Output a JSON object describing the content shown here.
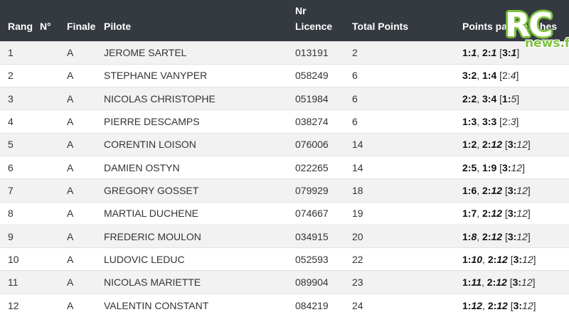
{
  "table": {
    "headers": {
      "rang": "Rang",
      "num": "N°",
      "finale": "Finale",
      "pilote": "Pilote",
      "licence_line1": "Nr",
      "licence_line2": "Licence",
      "total": "Total Points",
      "points": "Points par manches"
    },
    "rows": [
      {
        "rang": "1",
        "finale": "A",
        "pilote": "JEROME SARTEL",
        "licence": "013191",
        "total": "2",
        "points": [
          {
            "b": "1:",
            "i": "1"
          },
          {
            "sep": ", "
          },
          {
            "b": "2:",
            "i": "1"
          },
          {
            "sep": " ["
          },
          {
            "b": "3:",
            "i": "1"
          },
          {
            "sep": "]"
          }
        ]
      },
      {
        "rang": "2",
        "finale": "A",
        "pilote": "STEPHANE VANYPER",
        "licence": "058249",
        "total": "6",
        "points": [
          {
            "b": "3:2"
          },
          {
            "sep": ", "
          },
          {
            "b": "1:4"
          },
          {
            "sep": " [2:"
          },
          {
            "i": "4"
          },
          {
            "sep": "]"
          }
        ]
      },
      {
        "rang": "3",
        "finale": "A",
        "pilote": "NICOLAS CHRISTOPHE",
        "licence": "051984",
        "total": "6",
        "points": [
          {
            "b": "2:2"
          },
          {
            "sep": ", "
          },
          {
            "b": "3:4"
          },
          {
            "sep": " ["
          },
          {
            "b": "1:"
          },
          {
            "i": "5"
          },
          {
            "sep": "]"
          }
        ]
      },
      {
        "rang": "4",
        "finale": "A",
        "pilote": "PIERRE DESCAMPS",
        "licence": "038274",
        "total": "6",
        "points": [
          {
            "b": "1:3"
          },
          {
            "sep": ", "
          },
          {
            "b": "3:3"
          },
          {
            "sep": " [2:"
          },
          {
            "i": "3"
          },
          {
            "sep": "]"
          }
        ]
      },
      {
        "rang": "5",
        "finale": "A",
        "pilote": "CORENTIN LOISON",
        "licence": "076006",
        "total": "14",
        "points": [
          {
            "b": "1:2"
          },
          {
            "sep": ", "
          },
          {
            "b": "2:",
            "i": "12"
          },
          {
            "sep": " ["
          },
          {
            "b": "3:"
          },
          {
            "i": "12"
          },
          {
            "sep": "]"
          }
        ]
      },
      {
        "rang": "6",
        "finale": "A",
        "pilote": "DAMIEN OSTYN",
        "licence": "022265",
        "total": "14",
        "points": [
          {
            "b": "2:5"
          },
          {
            "sep": ", "
          },
          {
            "b": "1:9"
          },
          {
            "sep": " ["
          },
          {
            "b": "3:"
          },
          {
            "i": "12"
          },
          {
            "sep": "]"
          }
        ]
      },
      {
        "rang": "7",
        "finale": "A",
        "pilote": "GREGORY GOSSET",
        "licence": "079929",
        "total": "18",
        "points": [
          {
            "b": "1:6"
          },
          {
            "sep": ", "
          },
          {
            "b": "2:",
            "i": "12"
          },
          {
            "sep": " ["
          },
          {
            "b": "3:"
          },
          {
            "i": "12"
          },
          {
            "sep": "]"
          }
        ]
      },
      {
        "rang": "8",
        "finale": "A",
        "pilote": "MARTIAL DUCHENE",
        "licence": "074667",
        "total": "19",
        "points": [
          {
            "b": "1:7"
          },
          {
            "sep": ", "
          },
          {
            "b": "2:",
            "i": "12"
          },
          {
            "sep": " ["
          },
          {
            "b": "3:"
          },
          {
            "i": "12"
          },
          {
            "sep": "]"
          }
        ]
      },
      {
        "rang": "9",
        "finale": "A",
        "pilote": "FREDERIC MOULON",
        "licence": "034915",
        "total": "20",
        "points": [
          {
            "b": "1:",
            "i": "8"
          },
          {
            "sep": ", "
          },
          {
            "b": "2:",
            "i": "12"
          },
          {
            "sep": " ["
          },
          {
            "b": "3:"
          },
          {
            "i": "12"
          },
          {
            "sep": "]"
          }
        ]
      },
      {
        "rang": "10",
        "finale": "A",
        "pilote": "LUDOVIC LEDUC",
        "licence": "052593",
        "total": "22",
        "points": [
          {
            "b": "1:",
            "i": "10"
          },
          {
            "sep": ", "
          },
          {
            "b": "2:",
            "i": "12"
          },
          {
            "sep": " ["
          },
          {
            "b": "3:"
          },
          {
            "i": "12"
          },
          {
            "sep": "]"
          }
        ]
      },
      {
        "rang": "11",
        "finale": "A",
        "pilote": "NICOLAS MARIETTE",
        "licence": "089904",
        "total": "23",
        "points": [
          {
            "b": "1:",
            "i": "11"
          },
          {
            "sep": ", "
          },
          {
            "b": "2:",
            "i": "12"
          },
          {
            "sep": " ["
          },
          {
            "b": "3:"
          },
          {
            "i": "12"
          },
          {
            "sep": "]"
          }
        ]
      },
      {
        "rang": "12",
        "finale": "A",
        "pilote": "VALENTIN CONSTANT",
        "licence": "084219",
        "total": "24",
        "points": [
          {
            "b": "1:",
            "i": "12"
          },
          {
            "sep": ", "
          },
          {
            "b": "2:",
            "i": "12"
          },
          {
            "sep": " ["
          },
          {
            "b": "3:"
          },
          {
            "i": "12"
          },
          {
            "sep": "]"
          }
        ]
      }
    ]
  },
  "logo": {
    "rc": "RC",
    "news": "news.fr"
  },
  "colors": {
    "header_bg": "#343a40",
    "logo_green": "#7fc241",
    "stripe": "#f2f2f2"
  }
}
